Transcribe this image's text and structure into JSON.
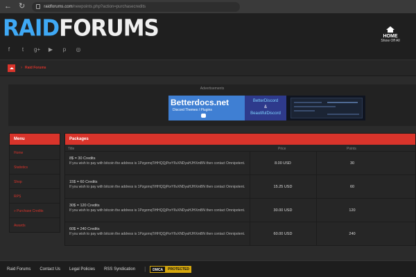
{
  "browser": {
    "url_host": "raidforums.com",
    "url_path": "/newpoints.php?action=purchasecredits",
    "back_glyph": "←",
    "reload_glyph": "↻"
  },
  "header": {
    "logo_part1": "RAID",
    "logo_part2": "FORUMS",
    "home_label": "HOME",
    "home_sub": "Show Off All",
    "social_icons": [
      "facebook-icon",
      "twitter-icon",
      "googleplus-icon",
      "youtube-icon",
      "pinterest-icon",
      "dribbble-icon"
    ],
    "social_glyphs": [
      "f",
      "t",
      "g+",
      "▶",
      "p",
      "◎"
    ]
  },
  "breadcrumb": {
    "separator": "›",
    "link": "Raid Forums"
  },
  "ad": {
    "label": "Advertisements",
    "title": "Betterdocs.net",
    "subtitle": "Discord Themes / Plugins",
    "mid_1": "BetterDiscord",
    "mid_2": "&",
    "mid_3": "BeautifulDiscord"
  },
  "menu": {
    "title": "Menu",
    "items": [
      "Home",
      "Statistics",
      "Shop",
      "RPS",
      "» Purchase Credits",
      "Awards"
    ]
  },
  "packages": {
    "title": "Packages",
    "col_title": "Title",
    "col_price": "Price",
    "col_points": "Points",
    "rows": [
      {
        "title": "8$ = 30 Credits",
        "desc": "If you wish to pay with bitcoin the address is 1PzgzmqTiHHQQjPorY6vXNDyaHJHXmBN then contact Omnipotent.",
        "price": "8.00 USD",
        "points": "30"
      },
      {
        "title": "15$ = 60 Credits",
        "desc": "If you wish to pay with bitcoin the address is 1PzgzmqTiHHQQjPorY6vXNDyaHJHXmBN then contact Omnipotent.",
        "price": "15.25 USD",
        "points": "60"
      },
      {
        "title": "30$ = 120 Credits",
        "desc": "If you wish to pay with bitcoin the address is 1PzgzmqTiHHQQjPorY6vXNDyaHJHXmBN then contact Omnipotent.",
        "price": "30.00 USD",
        "points": "120"
      },
      {
        "title": "60$ = 240 Credits",
        "desc": "If you wish to pay with bitcoin the address is 1PzgzmqTiHHQQjPorY6vXNDyaHJHXmBN then contact Omnipotent.",
        "price": "60.00 USD",
        "points": "240"
      }
    ]
  },
  "footer": {
    "links": [
      "Raid Forums",
      "Contact Us",
      "Legal Policies",
      "RSS Syndication"
    ],
    "dmca_1": "DMCA",
    "dmca_2": "PROTECTED"
  },
  "colors": {
    "accent": "#d9342b",
    "logo_blue": "#3fa9f5",
    "background": "#2b2b2b"
  }
}
